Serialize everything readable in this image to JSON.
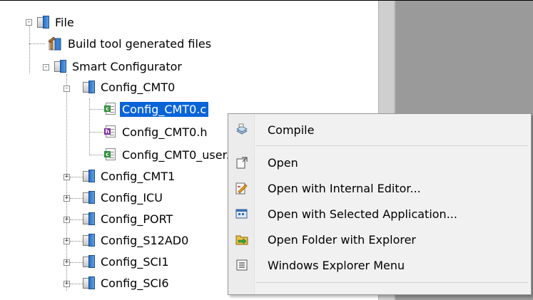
{
  "tree": {
    "root": {
      "label": "File",
      "expander": "-"
    },
    "build_tool": {
      "label": "Build tool generated files"
    },
    "smart_configurator": {
      "label": "Smart Configurator",
      "expander": "-"
    },
    "config_cmt0": {
      "label": "Config_CMT0",
      "expander": "-"
    },
    "files": [
      {
        "label": "Config_CMT0.c",
        "type": "c",
        "selected": true
      },
      {
        "label": "Config_CMT0.h",
        "type": "h",
        "selected": false
      },
      {
        "label": "Config_CMT0_user.c",
        "type": "c",
        "selected": false
      }
    ],
    "collapsed_folders": [
      {
        "label": "Config_CMT1",
        "expander": "+"
      },
      {
        "label": "Config_ICU",
        "expander": "+"
      },
      {
        "label": "Config_PORT",
        "expander": "+"
      },
      {
        "label": "Config_S12AD0",
        "expander": "+"
      },
      {
        "label": "Config_SCI1",
        "expander": "+"
      },
      {
        "label": "Config_SCI6",
        "expander": "+"
      }
    ]
  },
  "context_menu": {
    "items": [
      {
        "label": "Compile",
        "icon": "compile-icon"
      },
      {
        "label": "Open",
        "icon": "open-icon"
      },
      {
        "label": "Open with Internal Editor...",
        "icon": "internal-editor-icon"
      },
      {
        "label": "Open with Selected Application...",
        "icon": "selected-application-icon"
      },
      {
        "label": "Open Folder with Explorer",
        "icon": "explorer-folder-icon"
      },
      {
        "label": "Windows Explorer Menu",
        "icon": "explorer-menu-icon"
      }
    ]
  },
  "colors": {
    "selection": "#0a64d8",
    "menu_background": "#f1f1f1",
    "pane_background": "#9a9a9a"
  }
}
